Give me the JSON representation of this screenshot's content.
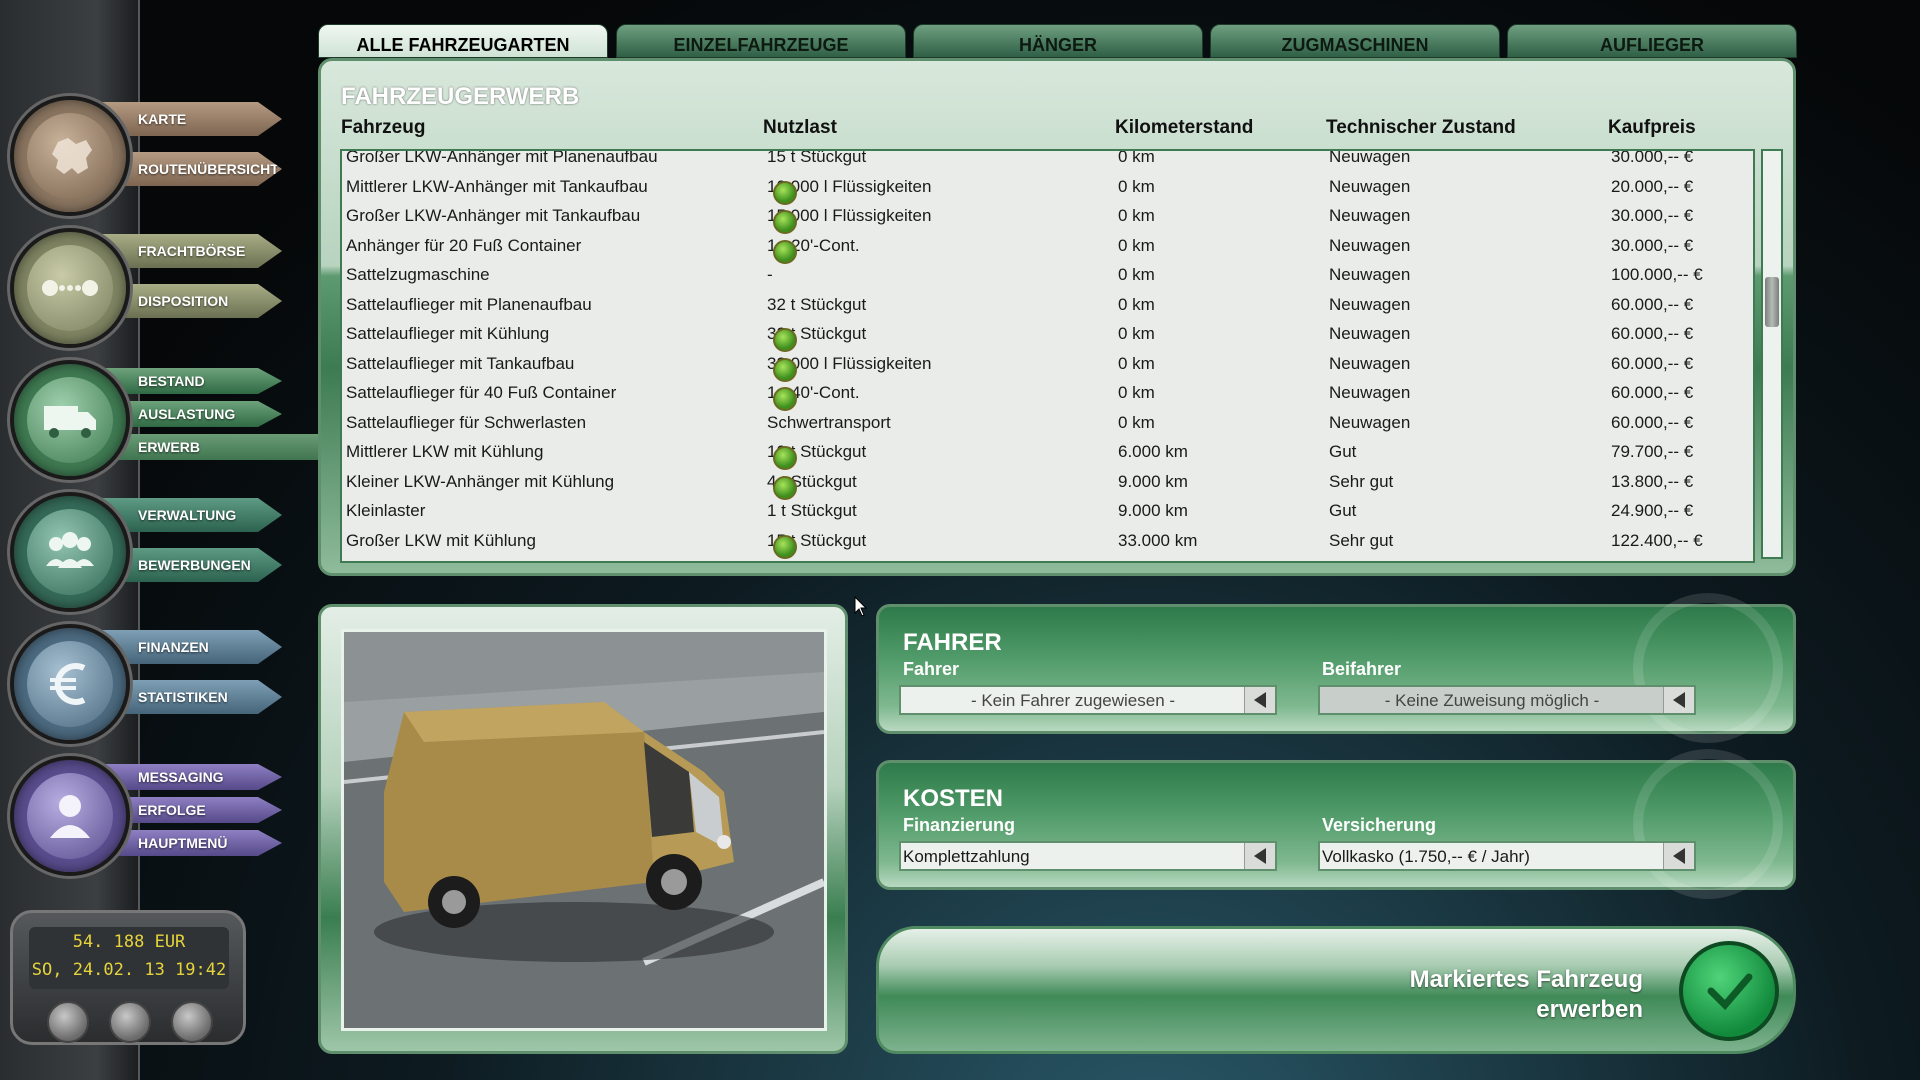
{
  "tabs": [
    {
      "label": "ALLE FAHRZEUGARTEN",
      "active": true
    },
    {
      "label": "EINZELFAHRZEUGE",
      "active": false
    },
    {
      "label": "HÄNGER",
      "active": false
    },
    {
      "label": "ZUGMASCHINEN",
      "active": false
    },
    {
      "label": "AUFLIEGER",
      "active": false
    }
  ],
  "sidebar": {
    "karte": "KARTE",
    "routen": "ROUTENÜBERSICHT",
    "fracht": "FRACHTBÖRSE",
    "dispo": "DISPOSITION",
    "bestand": "BESTAND",
    "auslastung": "AUSLASTUNG",
    "erwerb": "ERWERB",
    "verwaltung": "VERWALTUNG",
    "bewerbungen": "BEWERBUNGEN",
    "finanzen": "FINANZEN",
    "statistiken": "STATISTIKEN",
    "messaging": "MESSAGING",
    "erfolge": "ERFOLGE",
    "hauptmenu": "HAUPTMENÜ"
  },
  "clock": {
    "balance": "54. 188 EUR",
    "datetime": "SO, 24.02. 13 19:42"
  },
  "list": {
    "title": "FAHRZEUGERWERB",
    "headers": {
      "vehicle": "Fahrzeug",
      "payload": "Nutzlast",
      "mileage": "Kilometerstand",
      "condition": "Technischer Zustand",
      "price": "Kaufpreis"
    },
    "rows": [
      {
        "vehicle": "Großer LKW-Anhänger mit Planenaufbau",
        "payload": "15 t Stückgut",
        "icon": false,
        "mileage": "0 km",
        "condition": "Neuwagen",
        "price": "30.000,-- €"
      },
      {
        "vehicle": "Mittlerer LKW-Anhänger mit Tankaufbau",
        "payload": "10.000 l Flüssigkeiten",
        "icon": true,
        "mileage": "0 km",
        "condition": "Neuwagen",
        "price": "20.000,-- €"
      },
      {
        "vehicle": "Großer LKW-Anhänger mit Tankaufbau",
        "payload": "15.000 l Flüssigkeiten",
        "icon": true,
        "mileage": "0 km",
        "condition": "Neuwagen",
        "price": "30.000,-- €"
      },
      {
        "vehicle": "Anhänger für 20 Fuß Container",
        "payload": "1× 20'-Cont.",
        "icon": true,
        "mileage": "0 km",
        "condition": "Neuwagen",
        "price": "30.000,-- €"
      },
      {
        "vehicle": "Sattelzugmaschine",
        "payload": "-",
        "icon": false,
        "mileage": "0 km",
        "condition": "Neuwagen",
        "price": "100.000,-- €"
      },
      {
        "vehicle": "Sattelauflieger mit Planenaufbau",
        "payload": "32 t Stückgut",
        "icon": false,
        "mileage": "0 km",
        "condition": "Neuwagen",
        "price": "60.000,-- €"
      },
      {
        "vehicle": "Sattelauflieger mit Kühlung",
        "payload": "32 t Stückgut",
        "icon": true,
        "mileage": "0 km",
        "condition": "Neuwagen",
        "price": "60.000,-- €"
      },
      {
        "vehicle": "Sattelauflieger mit Tankaufbau",
        "payload": "32.000 l Flüssigkeiten",
        "icon": true,
        "mileage": "0 km",
        "condition": "Neuwagen",
        "price": "60.000,-- €"
      },
      {
        "vehicle": "Sattelauflieger für 40 Fuß Container",
        "payload": "1× 40'-Cont.",
        "icon": true,
        "mileage": "0 km",
        "condition": "Neuwagen",
        "price": "60.000,-- €"
      },
      {
        "vehicle": "Sattelauflieger für Schwerlasten",
        "payload": "Schwertransport",
        "icon": false,
        "mileage": "0 km",
        "condition": "Neuwagen",
        "price": "60.000,-- €"
      },
      {
        "vehicle": "Mittlerer LKW mit Kühlung",
        "payload": "10 t Stückgut",
        "icon": true,
        "mileage": "6.000 km",
        "condition": "Gut",
        "price": "79.700,-- €"
      },
      {
        "vehicle": "Kleiner LKW-Anhänger mit Kühlung",
        "payload": "4 t Stückgut",
        "icon": true,
        "mileage": "9.000 km",
        "condition": "Sehr gut",
        "price": "13.800,-- €"
      },
      {
        "vehicle": "Kleinlaster",
        "payload": "1 t Stückgut",
        "icon": false,
        "mileage": "9.000 km",
        "condition": "Gut",
        "price": "24.900,-- €"
      },
      {
        "vehicle": "Großer LKW mit Kühlung",
        "payload": "15 t Stückgut",
        "icon": true,
        "mileage": "33.000 km",
        "condition": "Sehr gut",
        "price": "122.400,-- €"
      }
    ]
  },
  "driver": {
    "title": "FAHRER",
    "driver_label": "Fahrer",
    "driver_value": "- Kein Fahrer zugewiesen -",
    "codriver_label": "Beifahrer",
    "codriver_value": "- Keine Zuweisung möglich -"
  },
  "costs": {
    "title": "KOSTEN",
    "financing_label": "Finanzierung",
    "financing_value": "Komplettzahlung",
    "insurance_label": "Versicherung",
    "insurance_value": "Vollkasko (1.750,-- € / Jahr)"
  },
  "buy": {
    "line1": "Markiertes Fahrzeug",
    "line2": "erwerben"
  },
  "icons": {
    "karte": "europe-map-icon",
    "fracht": "route-dots-icon",
    "bestand": "truck-icon",
    "verwaltung": "people-group-icon",
    "finanzen": "euro-icon",
    "messaging": "person-icon",
    "cargo": "cargo-type-icon",
    "buy": "checkmark-icon"
  }
}
